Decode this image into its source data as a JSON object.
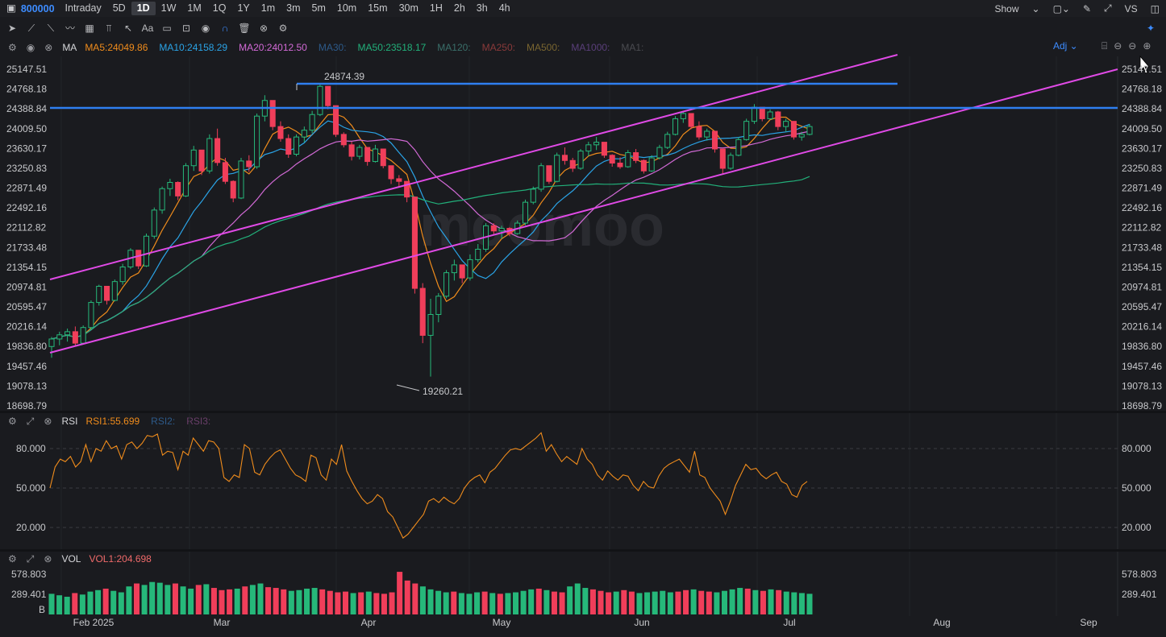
{
  "topbar": {
    "symbol": "800000",
    "timeframes": [
      "Intraday",
      "5D",
      "1D",
      "1W",
      "1M",
      "1Q",
      "1Y",
      "1m",
      "3m",
      "5m",
      "10m",
      "15m",
      "30m",
      "1H",
      "2h",
      "3h",
      "4h"
    ],
    "active_timeframe": "1D",
    "show_label": "Show",
    "vs_label": "VS"
  },
  "ma_panel": {
    "name": "MA",
    "items": [
      {
        "label": "MA5:24049.86",
        "color": "#f08c1c"
      },
      {
        "label": "MA10:24158.29",
        "color": "#2aa3e6"
      },
      {
        "label": "MA20:24012.50",
        "color": "#d26ad6"
      },
      {
        "label": "MA30:",
        "color": "#2d5a8a"
      },
      {
        "label": "MA50:23518.17",
        "color": "#22b07a"
      },
      {
        "label": "MA120:",
        "color": "#3a6f6a"
      },
      {
        "label": "MA250:",
        "color": "#8a3a3a"
      },
      {
        "label": "MA500:",
        "color": "#7a6630"
      },
      {
        "label": "MA1000:",
        "color": "#5a3f7a"
      },
      {
        "label": "MA1:",
        "color": "#4a4b50"
      }
    ],
    "adj_label": "Adj"
  },
  "rsi_panel": {
    "name": "RSI",
    "items": [
      {
        "label": "RSI1:55.699",
        "color": "#f08c1c"
      },
      {
        "label": "RSI2:",
        "color": "#2d5a8a"
      },
      {
        "label": "RSI3:",
        "color": "#6a3f6a"
      }
    ],
    "ticks": [
      "80.000",
      "50.000",
      "20.000"
    ]
  },
  "vol_panel": {
    "name": "VOL",
    "items": [
      {
        "label": "VOL1:204.698",
        "color": "#f06a6a"
      }
    ],
    "ticks": [
      "578.803",
      "289.401",
      "B"
    ]
  },
  "price_axis": [
    "25147.51",
    "24768.18",
    "24388.84",
    "24009.50",
    "23630.17",
    "23250.83",
    "22871.49",
    "22492.16",
    "22112.82",
    "21733.48",
    "21354.15",
    "20974.81",
    "20595.47",
    "20216.14",
    "19836.80",
    "19457.46",
    "19078.13",
    "18698.79"
  ],
  "annotations": {
    "high": "24874.39",
    "low": "19260.21"
  },
  "watermark": "moomoo",
  "months": [
    {
      "label": "Feb 2025",
      "x": 116
    },
    {
      "label": "Mar",
      "x": 275
    },
    {
      "label": "Apr",
      "x": 457
    },
    {
      "label": "May",
      "x": 622
    },
    {
      "label": "Jun",
      "x": 796
    },
    {
      "label": "Jul",
      "x": 979
    },
    {
      "label": "Aug",
      "x": 1168
    },
    {
      "label": "Sep",
      "x": 1350
    }
  ],
  "chart_data": {
    "type": "candlestick",
    "title": "",
    "y_range": [
      18698.79,
      25147.51
    ],
    "candles": [
      [
        19836,
        20020,
        19620,
        19980
      ],
      [
        19980,
        20120,
        19860,
        20060
      ],
      [
        20060,
        20180,
        19930,
        20120
      ],
      [
        20120,
        20220,
        19840,
        19900
      ],
      [
        19900,
        20240,
        19880,
        20200
      ],
      [
        20200,
        20720,
        20160,
        20680
      ],
      [
        20680,
        21020,
        20620,
        20990
      ],
      [
        20990,
        20960,
        20640,
        20720
      ],
      [
        20720,
        21120,
        20700,
        21080
      ],
      [
        21080,
        21420,
        21020,
        21360
      ],
      [
        21360,
        21720,
        21320,
        21680
      ],
      [
        21680,
        21600,
        21320,
        21380
      ],
      [
        21380,
        22000,
        21360,
        21950
      ],
      [
        21950,
        22500,
        21900,
        22450
      ],
      [
        22450,
        22900,
        22380,
        22860
      ],
      [
        22860,
        23050,
        22720,
        22980
      ],
      [
        22980,
        23000,
        22640,
        22720
      ],
      [
        22720,
        23350,
        22700,
        23300
      ],
      [
        23300,
        23680,
        23200,
        23600
      ],
      [
        23600,
        23550,
        23120,
        23200
      ],
      [
        23200,
        23900,
        23150,
        23820
      ],
      [
        23820,
        24010,
        23300,
        23360
      ],
      [
        23360,
        23450,
        22950,
        23000
      ],
      [
        23000,
        23020,
        22600,
        22680
      ],
      [
        22680,
        23450,
        22660,
        23390
      ],
      [
        23390,
        23500,
        23180,
        23280
      ],
      [
        23280,
        24300,
        23240,
        24250
      ],
      [
        24250,
        24650,
        24150,
        24550
      ],
      [
        24550,
        24480,
        23980,
        24050
      ],
      [
        24050,
        24150,
        23760,
        23820
      ],
      [
        23820,
        23900,
        23450,
        23520
      ],
      [
        23520,
        23900,
        23480,
        23850
      ],
      [
        23850,
        24050,
        23750,
        23980
      ],
      [
        23980,
        24350,
        23920,
        24280
      ],
      [
        24280,
        24874,
        24250,
        24820
      ],
      [
        24820,
        24760,
        24380,
        24450
      ],
      [
        24450,
        24380,
        23850,
        23900
      ],
      [
        23900,
        23940,
        23650,
        23700
      ],
      [
        23700,
        23760,
        23400,
        23480
      ],
      [
        23480,
        23700,
        23420,
        23650
      ],
      [
        23650,
        23600,
        23300,
        23380
      ],
      [
        23380,
        23700,
        23360,
        23620
      ],
      [
        23620,
        23580,
        23250,
        23300
      ],
      [
        23300,
        23200,
        22950,
        23050
      ],
      [
        23050,
        23120,
        22900,
        23000
      ],
      [
        23000,
        22860,
        22600,
        22700
      ],
      [
        22700,
        22150,
        20850,
        20950
      ],
      [
        20950,
        21050,
        19900,
        20050
      ],
      [
        20050,
        20750,
        19260,
        20450
      ],
      [
        20450,
        20860,
        20300,
        20800
      ],
      [
        20800,
        21300,
        20760,
        21250
      ],
      [
        21250,
        21500,
        21100,
        21400
      ],
      [
        21400,
        21350,
        21050,
        21150
      ],
      [
        21150,
        21600,
        21100,
        21500
      ],
      [
        21500,
        21800,
        21450,
        21700
      ],
      [
        21700,
        22200,
        21650,
        22150
      ],
      [
        22150,
        22200,
        21980,
        22050
      ],
      [
        22050,
        22150,
        21900,
        22100
      ],
      [
        22100,
        22120,
        21950,
        22000
      ],
      [
        22000,
        22250,
        21980,
        22200
      ],
      [
        22200,
        22650,
        22160,
        22600
      ],
      [
        22600,
        22900,
        22560,
        22850
      ],
      [
        22850,
        23350,
        22800,
        23300
      ],
      [
        23300,
        23280,
        22950,
        23000
      ],
      [
        23000,
        23550,
        22980,
        23500
      ],
      [
        23500,
        23650,
        23320,
        23400
      ],
      [
        23400,
        23450,
        23180,
        23250
      ],
      [
        23250,
        23620,
        23220,
        23580
      ],
      [
        23580,
        23760,
        23480,
        23700
      ],
      [
        23700,
        23850,
        23600,
        23750
      ],
      [
        23750,
        23700,
        23450,
        23500
      ],
      [
        23500,
        23520,
        23280,
        23350
      ],
      [
        23350,
        23460,
        23240,
        23280
      ],
      [
        23280,
        23600,
        23260,
        23550
      ],
      [
        23550,
        23620,
        23350,
        23400
      ],
      [
        23400,
        23420,
        23150,
        23200
      ],
      [
        23200,
        23500,
        23180,
        23450
      ],
      [
        23450,
        23700,
        23420,
        23650
      ],
      [
        23650,
        23950,
        23620,
        23900
      ],
      [
        23900,
        24250,
        23880,
        24200
      ],
      [
        24200,
        24350,
        24120,
        24300
      ],
      [
        24300,
        24280,
        24000,
        24050
      ],
      [
        24050,
        24150,
        23800,
        23850
      ],
      [
        23850,
        24010,
        23780,
        23960
      ],
      [
        23960,
        23900,
        23550,
        23620
      ],
      [
        23620,
        23600,
        23150,
        23250
      ],
      [
        23250,
        23550,
        23220,
        23500
      ],
      [
        23500,
        23850,
        23480,
        23800
      ],
      [
        23800,
        24200,
        23780,
        24150
      ],
      [
        24150,
        24480,
        24100,
        24420
      ],
      [
        24420,
        24400,
        24150,
        24200
      ],
      [
        24200,
        24380,
        24180,
        24330
      ],
      [
        24330,
        24350,
        23980,
        24050
      ],
      [
        24050,
        24200,
        23950,
        24150
      ],
      [
        24150,
        24120,
        23800,
        23850
      ],
      [
        23850,
        23950,
        23780,
        23900
      ],
      [
        23900,
        24100,
        23880,
        24050
      ]
    ],
    "rsi": [
      50,
      66,
      72,
      70,
      74,
      66,
      70,
      83,
      70,
      80,
      78,
      86,
      80,
      82,
      72,
      83,
      85,
      80,
      84,
      90,
      89,
      91,
      75,
      78,
      77,
      64,
      78,
      75,
      88,
      83,
      78,
      86,
      85,
      80,
      58,
      55,
      60,
      58,
      83,
      80,
      62,
      60,
      68,
      73,
      77,
      79,
      72,
      65,
      60,
      58,
      55,
      75,
      73,
      60,
      56,
      72,
      68,
      83,
      63,
      55,
      48,
      42,
      38,
      40,
      45,
      42,
      32,
      28,
      20,
      12,
      15,
      20,
      25,
      30,
      40,
      42,
      39,
      43,
      40,
      38,
      42,
      50,
      55,
      58,
      60,
      54,
      62,
      65,
      70,
      75,
      79,
      80,
      79,
      82,
      85,
      88,
      92,
      78,
      83,
      76,
      70,
      74,
      71,
      68,
      80,
      72,
      68,
      60,
      56,
      63,
      59,
      56,
      60,
      59,
      52,
      48,
      55,
      51,
      50,
      59,
      65,
      68,
      70,
      72,
      67,
      62,
      78,
      60,
      58,
      50,
      45,
      40,
      30,
      40,
      52,
      60,
      68,
      64,
      65,
      60,
      57,
      60,
      62,
      55,
      53,
      45,
      43,
      52,
      55
    ],
    "volume": [
      280,
      260,
      240,
      290,
      270,
      310,
      330,
      350,
      320,
      300,
      380,
      420,
      400,
      440,
      430,
      400,
      420,
      380,
      350,
      400,
      410,
      360,
      330,
      340,
      350,
      380,
      400,
      420,
      370,
      360,
      340,
      320,
      330,
      350,
      360,
      340,
      320,
      300,
      310,
      290,
      300,
      310,
      290,
      280,
      300,
      578,
      460,
      420,
      380,
      340,
      320,
      300,
      310,
      290,
      280,
      300,
      310,
      290,
      280,
      290,
      300,
      320,
      340,
      350,
      330,
      310,
      300,
      380,
      420,
      360,
      340,
      320,
      300,
      310,
      330,
      310,
      290,
      300,
      310,
      320,
      300,
      310,
      330,
      340,
      320,
      310,
      300,
      320,
      340,
      360,
      350,
      330,
      320,
      340,
      330,
      310,
      300,
      290,
      280
    ]
  }
}
